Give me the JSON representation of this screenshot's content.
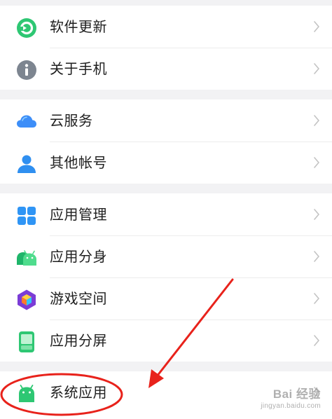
{
  "groups": [
    {
      "items": [
        {
          "label": "软件更新",
          "icon": "software-update-icon"
        },
        {
          "label": "关于手机",
          "icon": "info-icon"
        }
      ]
    },
    {
      "items": [
        {
          "label": "云服务",
          "icon": "cloud-icon"
        },
        {
          "label": "其他帐号",
          "icon": "person-icon"
        }
      ]
    },
    {
      "items": [
        {
          "label": "应用管理",
          "icon": "app-grid-icon"
        },
        {
          "label": "应用分身",
          "icon": "android-clone-icon"
        },
        {
          "label": "游戏空间",
          "icon": "game-cube-icon"
        },
        {
          "label": "应用分屏",
          "icon": "split-screen-icon"
        }
      ]
    },
    {
      "items": [
        {
          "label": "系统应用",
          "icon": "android-system-icon"
        }
      ]
    }
  ],
  "colors": {
    "accent_green": "#2ec773",
    "info_gray": "#7d8590",
    "cloud_blue": "#3d8ef8",
    "annotation_red": "#e8221b"
  },
  "watermark": {
    "brand": "Bai 经验",
    "url": "jingyan.baidu.com"
  }
}
